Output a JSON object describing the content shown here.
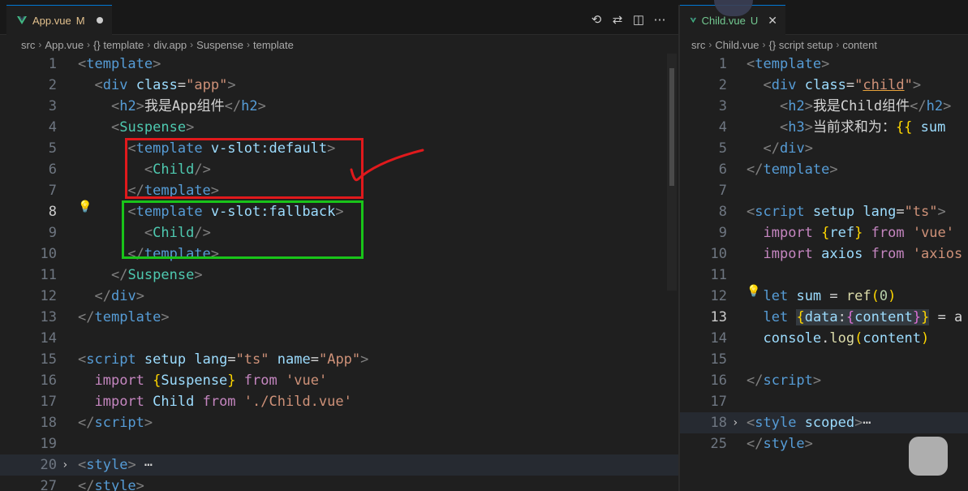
{
  "left": {
    "tab": {
      "name": "App.vue",
      "status": "M"
    },
    "breadcrumb": [
      "src",
      "App.vue",
      "{} template",
      "div.app",
      "Suspense",
      "template"
    ],
    "lines": [
      {
        "n": "1",
        "html": "<span class='tg'>&lt;</span><span class='tn'>template</span><span class='tg'>&gt;</span>"
      },
      {
        "n": "2",
        "html": "  <span class='tg'>&lt;</span><span class='tn'>div</span> <span class='at'>class</span><span class='pl'>=</span><span class='st'>\"app\"</span><span class='tg'>&gt;</span>"
      },
      {
        "n": "3",
        "html": "    <span class='tg'>&lt;</span><span class='tn'>h2</span><span class='tg'>&gt;</span><span class='pl'>我是App组件</span><span class='tg'>&lt;/</span><span class='tn'>h2</span><span class='tg'>&gt;</span>"
      },
      {
        "n": "4",
        "html": "    <span class='tg'>&lt;</span><span class='cn'>Suspense</span><span class='tg'>&gt;</span>"
      },
      {
        "n": "5",
        "html": "      <span class='tg'>&lt;</span><span class='tn'>template</span> <span class='at'>v-slot:default</span><span class='tg'>&gt;</span>"
      },
      {
        "n": "6",
        "html": "        <span class='tg'>&lt;</span><span class='cn'>Child</span><span class='tg'>/&gt;</span>"
      },
      {
        "n": "7",
        "html": "      <span class='tg'>&lt;/</span><span class='tn'>template</span><span class='tg'>&gt;</span>"
      },
      {
        "n": "8",
        "html": "      <span class='tg'>&lt;</span><span class='tn'>template</span> <span class='at'>v-slot:fallback</span><span class='tg'>&gt;</span>",
        "cur": true
      },
      {
        "n": "9",
        "html": "        <span class='tg'>&lt;</span><span class='cn'>Child</span><span class='tg'>/&gt;</span>"
      },
      {
        "n": "10",
        "html": "      <span class='tg'>&lt;/</span><span class='tn'>template</span><span class='tg'>&gt;</span>"
      },
      {
        "n": "11",
        "html": "    <span class='tg'>&lt;/</span><span class='cn'>Suspense</span><span class='tg'>&gt;</span>"
      },
      {
        "n": "12",
        "html": "  <span class='tg'>&lt;/</span><span class='tn'>div</span><span class='tg'>&gt;</span>"
      },
      {
        "n": "13",
        "html": "<span class='tg'>&lt;/</span><span class='tn'>template</span><span class='tg'>&gt;</span>"
      },
      {
        "n": "14",
        "html": ""
      },
      {
        "n": "15",
        "html": "<span class='tg'>&lt;</span><span class='tn'>script</span> <span class='at'>setup</span> <span class='at'>lang</span><span class='pl'>=</span><span class='st'>\"ts\"</span> <span class='at'>name</span><span class='pl'>=</span><span class='st'>\"App\"</span><span class='tg'>&gt;</span>"
      },
      {
        "n": "16",
        "html": "  <span class='kw'>import</span> <span class='br1'>{</span><span class='vr'>Suspense</span><span class='br1'>}</span> <span class='kw'>from</span> <span class='st'>'vue'</span>"
      },
      {
        "n": "17",
        "html": "  <span class='kw'>import</span> <span class='vr'>Child</span> <span class='kw'>from</span> <span class='st'>'./Child.vue'</span>"
      },
      {
        "n": "18",
        "html": "<span class='tg'>&lt;/</span><span class='tn'>script</span><span class='tg'>&gt;</span>"
      },
      {
        "n": "19",
        "html": ""
      },
      {
        "n": "20",
        "html": "<span class='tg'>&lt;</span><span class='tn'>style</span><span class='tg'>&gt;</span><span class='pl'> ⋯</span>",
        "hl": true,
        "fold": true
      },
      {
        "n": "27",
        "html": "<span class='tg'>&lt;/</span><span class='tn'>style</span><span class='tg'>&gt;</span>"
      }
    ]
  },
  "right": {
    "tab": {
      "name": "Child.vue",
      "status": "U"
    },
    "breadcrumb": [
      "src",
      "Child.vue",
      "{} script setup",
      "content"
    ],
    "lines": [
      {
        "n": "1",
        "html": "<span class='tg'>&lt;</span><span class='tn'>template</span><span class='tg'>&gt;</span>"
      },
      {
        "n": "2",
        "html": "  <span class='tg'>&lt;</span><span class='tn'>div</span> <span class='at'>class</span><span class='pl'>=</span><span class='st'>\"<u style='text-decoration-color:#e8a33b'>child</u>\"</span><span class='tg'>&gt;</span>"
      },
      {
        "n": "3",
        "html": "    <span class='tg'>&lt;</span><span class='tn'>h2</span><span class='tg'>&gt;</span><span class='pl'>我是Child组件</span><span class='tg'>&lt;/</span><span class='tn'>h2</span><span class='tg'>&gt;</span>"
      },
      {
        "n": "4",
        "html": "    <span class='tg'>&lt;</span><span class='tn'>h3</span><span class='tg'>&gt;</span><span class='pl'>当前求和为：</span><span class='br1'>{{</span> <span class='vr'>sum</span>"
      },
      {
        "n": "5",
        "html": "  <span class='tg'>&lt;/</span><span class='tn'>div</span><span class='tg'>&gt;</span>"
      },
      {
        "n": "6",
        "html": "<span class='tg'>&lt;/</span><span class='tn'>template</span><span class='tg'>&gt;</span>"
      },
      {
        "n": "7",
        "html": ""
      },
      {
        "n": "8",
        "html": "<span class='tg'>&lt;</span><span class='tn'>script</span> <span class='at'>setup</span> <span class='at'>lang</span><span class='pl'>=</span><span class='st'>\"ts\"</span><span class='tg'>&gt;</span>"
      },
      {
        "n": "9",
        "html": "  <span class='kw'>import</span> <span class='br1'>{</span><span class='vr'>ref</span><span class='br1'>}</span> <span class='kw'>from</span> <span class='st'>'vue'</span>"
      },
      {
        "n": "10",
        "html": "  <span class='kw'>import</span> <span class='vr'>axios</span> <span class='kw'>from</span> <span class='st'>'axios</span>"
      },
      {
        "n": "11",
        "html": ""
      },
      {
        "n": "12",
        "html": "  <span class='tn'>let</span> <span class='vr'>sum</span> <span class='pl'>=</span> <span class='fn'>ref</span><span class='br1'>(</span><span class='nm'>0</span><span class='br1'>)</span>"
      },
      {
        "n": "13",
        "html": "  <span class='tn'>let</span> <span style='background:#343a40'><span class='br1'>{</span><span class='vr'>data</span><span class='pl'>:</span><span class='br2'>{</span><span class='vr'>content</span><span class='br2'>}</span><span class='br1'>}</span></span> <span class='pl'>= a</span>",
        "cur": true
      },
      {
        "n": "14",
        "html": "  <span class='vr'>console</span><span class='pl'>.</span><span class='fn'>log</span><span class='br1'>(</span><span class='vr'>content</span><span class='br1'>)</span>"
      },
      {
        "n": "15",
        "html": ""
      },
      {
        "n": "16",
        "html": "<span class='tg'>&lt;/</span><span class='tn'>script</span><span class='tg'>&gt;</span>"
      },
      {
        "n": "17",
        "html": ""
      },
      {
        "n": "18",
        "html": "<span class='tg'>&lt;</span><span class='tn'>style</span> <span class='at'>scoped</span><span class='tg'>&gt;</span><span class='pl'>⋯</span>",
        "hl": true,
        "fold": true
      },
      {
        "n": "25",
        "html": "<span class='tg'>&lt;/</span><span class='tn'>style</span><span class='tg'>&gt;</span>"
      }
    ]
  }
}
